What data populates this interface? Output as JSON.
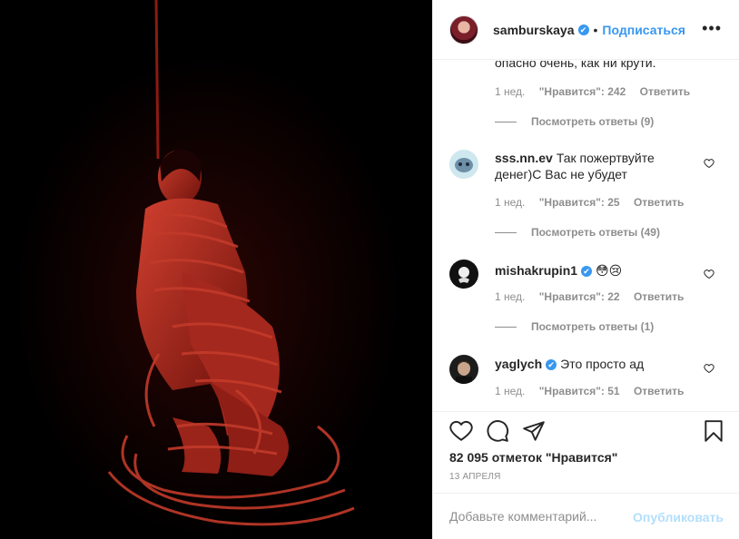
{
  "header": {
    "username": "samburskaya",
    "verified_mark": "✔",
    "separator": "•",
    "follow_label": "Подписаться",
    "more_icon": "more-horizontal-icon",
    "more_glyph": "•••"
  },
  "comments": [
    {
      "partial_text": "опасно очень, как ни крути.",
      "time": "1 нед.",
      "likes": "\"Нравится\": 242",
      "reply": "Ответить",
      "view_replies": "Посмотреть ответы (9)"
    },
    {
      "username": "sss.nn.ev",
      "text": "Так пожертвуйте денег)С Вас не убудет",
      "time": "1 нед.",
      "likes": "\"Нравится\": 25",
      "reply": "Ответить",
      "view_replies": "Посмотреть ответы (49)"
    },
    {
      "username": "mishakrupin1",
      "verified_mark": "✔",
      "text": "😳😢",
      "time": "1 нед.",
      "likes": "\"Нравится\": 22",
      "reply": "Ответить",
      "view_replies": "Посмотреть ответы (1)"
    },
    {
      "username": "yaglych",
      "verified_mark": "✔",
      "text": "Это просто ад",
      "time": "1 нед.",
      "likes": "\"Нравится\": 51",
      "reply": "Ответить"
    }
  ],
  "actions": {
    "icons": [
      "heart-icon",
      "comment-icon",
      "share-icon",
      "bookmark-icon"
    ],
    "likes_count": "82 095 отметок \"Нравится\"",
    "date": "13 АПРЕЛЯ"
  },
  "add_comment": {
    "placeholder": "Добавьте комментарий...",
    "publish_label": "Опубликовать"
  },
  "colors": {
    "accent": "#3897f0",
    "muted": "#8e8e8e",
    "publish_disabled": "#b2dffc",
    "photo_red": "#b3281f"
  }
}
